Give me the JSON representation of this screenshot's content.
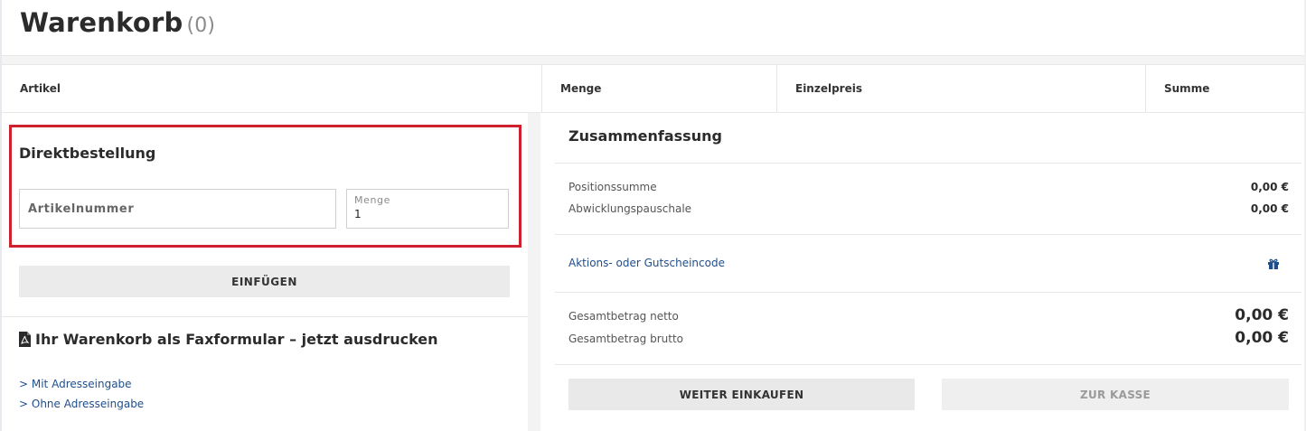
{
  "header": {
    "title": "Warenkorb",
    "count": "(0)"
  },
  "table": {
    "columns": [
      "Artikel",
      "Menge",
      "Einzelpreis",
      "Summe"
    ]
  },
  "direct_order": {
    "title": "Direktbestellung",
    "article_placeholder": "Artikelnummer",
    "quantity_label": "Menge",
    "quantity_value": "1",
    "insert_label": "EINFÜGEN"
  },
  "fax": {
    "icon": "pdf-icon",
    "title": "Ihr Warenkorb als Faxformular – jetzt ausdrucken",
    "links": [
      "> Mit Adresseingabe",
      "> Ohne Adresseingabe"
    ]
  },
  "summary": {
    "title": "Zusammenfassung",
    "position_sum_label": "Positionssumme",
    "position_sum_value": "0,00 €",
    "handling_fee_label": "Abwicklungspauschale",
    "handling_fee_value": "0,00 €",
    "coupon_label": "Aktions- oder Gutscheincode",
    "coupon_icon": "gift-icon",
    "net_total_label": "Gesamtbetrag netto",
    "net_total_value": "0,00 €",
    "gross_total_label": "Gesamtbetrag brutto",
    "gross_total_value": "0,00 €",
    "continue_label": "WEITER EINKAUFEN",
    "checkout_label": "ZUR KASSE"
  },
  "colors": {
    "highlight_border": "#d0202e",
    "link": "#1f4e8c",
    "button_bg": "#ebebeb"
  }
}
